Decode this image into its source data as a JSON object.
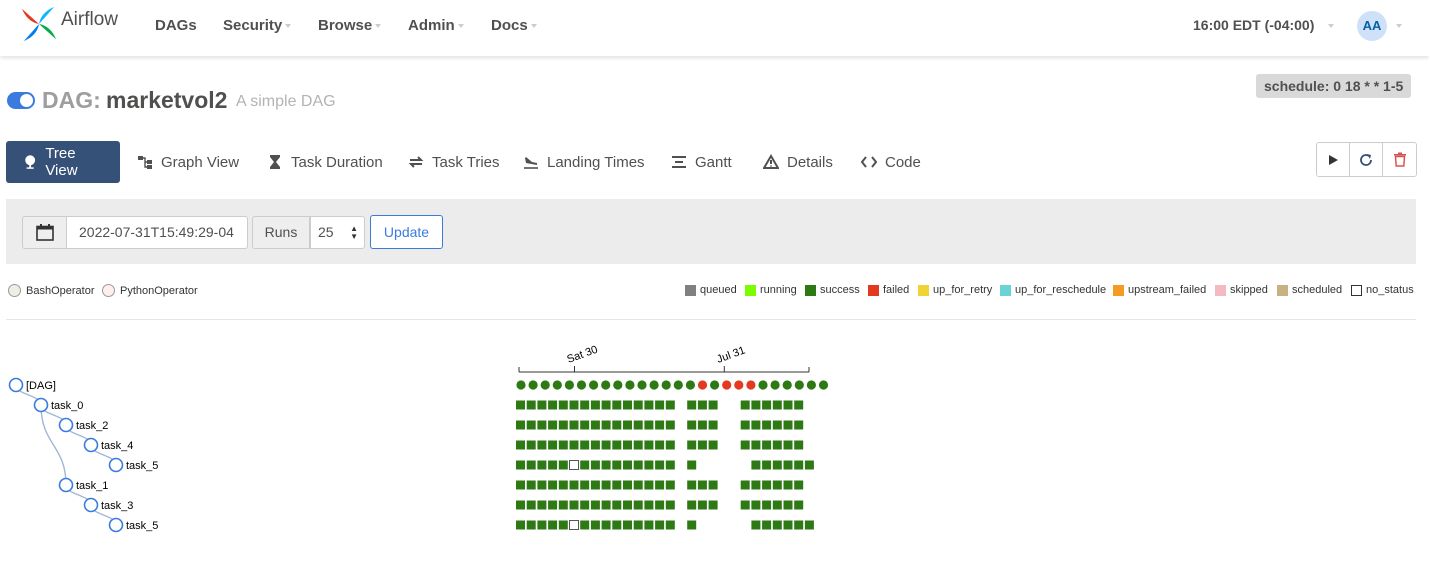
{
  "app": {
    "brand": "Airflow"
  },
  "nav": {
    "items": [
      {
        "label": "DAGs",
        "caret": false
      },
      {
        "label": "Security",
        "caret": true
      },
      {
        "label": "Browse",
        "caret": true
      },
      {
        "label": "Admin",
        "caret": true
      },
      {
        "label": "Docs",
        "caret": true
      }
    ],
    "timezone": "16:00 EDT (-04:00)",
    "user_initials": "AA"
  },
  "dag": {
    "label": "DAG:",
    "name": "marketvol2",
    "description": "A simple DAG",
    "schedule": "schedule: 0 18 * * 1-5",
    "paused": false
  },
  "tabs": [
    {
      "label": "Tree View",
      "icon": "tree-icon",
      "active": true
    },
    {
      "label": "Graph View",
      "icon": "graph-icon",
      "active": false
    },
    {
      "label": "Task Duration",
      "icon": "hourglass-icon",
      "active": false
    },
    {
      "label": "Task Tries",
      "icon": "retry-icon",
      "active": false
    },
    {
      "label": "Landing Times",
      "icon": "plane-landing-icon",
      "active": false
    },
    {
      "label": "Gantt",
      "icon": "gantt-icon",
      "active": false
    },
    {
      "label": "Details",
      "icon": "warning-triangle-icon",
      "active": false
    },
    {
      "label": "Code",
      "icon": "code-icon",
      "active": false
    }
  ],
  "actions": [
    {
      "name": "trigger-dag-button",
      "icon": "play-icon"
    },
    {
      "name": "refresh-button",
      "icon": "refresh-icon"
    },
    {
      "name": "delete-dag-button",
      "icon": "trash-icon"
    }
  ],
  "filter": {
    "base_date": "2022-07-31T15:49:29-04",
    "runs_label": "Runs",
    "runs_value": "25",
    "update_label": "Update"
  },
  "operators": [
    {
      "label": "BashOperator",
      "color": "#f0ede4"
    },
    {
      "label": "PythonOperator",
      "color": "#ffefeb"
    }
  ],
  "states": [
    {
      "label": "queued",
      "color": "#808080"
    },
    {
      "label": "running",
      "color": "#7cfc00"
    },
    {
      "label": "success",
      "color": "#2d7a14"
    },
    {
      "label": "failed",
      "color": "#e43921"
    },
    {
      "label": "up_for_retry",
      "color": "#f0d436"
    },
    {
      "label": "up_for_reschedule",
      "color": "#6ad3d3"
    },
    {
      "label": "upstream_failed",
      "color": "#f39c21"
    },
    {
      "label": "skipped",
      "color": "#f5b9c1"
    },
    {
      "label": "scheduled",
      "color": "#c8b282"
    },
    {
      "label": "no_status",
      "color": "#ffffff"
    }
  ],
  "timeline": {
    "axis_labels": [
      "Sat 30",
      "Jul 31"
    ],
    "axis_label_runs": [
      5,
      19
    ],
    "run_count": 29
  },
  "tree": {
    "nodes": [
      {
        "label": "[DAG]",
        "depth": 0
      },
      {
        "label": "task_0",
        "depth": 1
      },
      {
        "label": "task_2",
        "depth": 2
      },
      {
        "label": "task_4",
        "depth": 3
      },
      {
        "label": "task_5",
        "depth": 4
      },
      {
        "label": "task_1",
        "depth": 2
      },
      {
        "label": "task_3",
        "depth": 3
      },
      {
        "label": "task_5",
        "depth": 4
      }
    ],
    "parents": [
      -1,
      0,
      1,
      2,
      3,
      1,
      5,
      6
    ],
    "dag_runs": "SSSSSSSSSSSSSSSFSFFFSSSSSS",
    "task_rows": [
      "SSSSSSSSSSSSSSS-SSS--SSSSSS",
      "SSSSSSSSSSSSSSS-SSS--SSSSSS",
      "SSSSSSSSSSSSSSS-SSS--SSSSSS",
      "SSSSSNSSSSSSSSS-S-----SSSSSS",
      "SSSSSSSSSSSSSSS-SSS--SSSSSS",
      "SSSSSSSSSSSSSSS-SSS--SSSSSS",
      "SSSSSNSSSSSSSSS-S-----SSSSSS"
    ]
  }
}
